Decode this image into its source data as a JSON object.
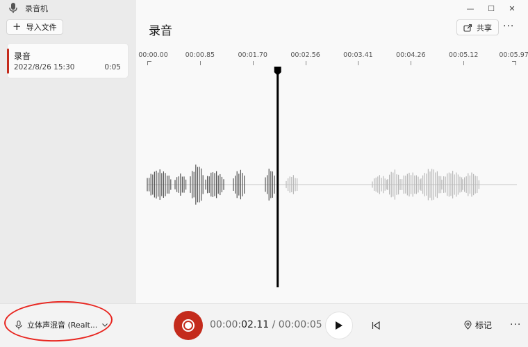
{
  "app": {
    "title": "录音机",
    "logo_icon": "microphone-icon"
  },
  "sidebar": {
    "import_label": "导入文件",
    "import_icon": "plus-icon",
    "recordings": [
      {
        "name": "录音",
        "date": "2022/8/26 15:30",
        "duration": "0:05"
      }
    ]
  },
  "main": {
    "title": "录音",
    "share_label": "共享",
    "share_icon": "share-icon",
    "more_icon": "more-icon",
    "window_controls": [
      "minimize-icon",
      "maximize-icon",
      "close-icon"
    ]
  },
  "timeline": {
    "ticks": [
      "00:00.00",
      "00:00.85",
      "00:01.70",
      "00:02.56",
      "00:03.41",
      "00:04.26",
      "00:05.12",
      "00:05.97"
    ],
    "playhead_seconds": 2.11,
    "total_seconds": 5.97
  },
  "bottom": {
    "input_device": "立体声混音 (Realt...",
    "time_prefix": "00:00:",
    "time_current": "02.11",
    "time_sep": " / ",
    "time_total": "00:00:05",
    "mark_label": "标记",
    "colors": {
      "record": "#c42b1c",
      "annotation": "#e8251f"
    }
  }
}
